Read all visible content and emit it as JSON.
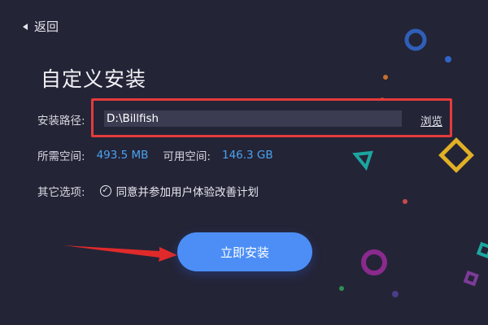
{
  "nav": {
    "back_label": "返回"
  },
  "page": {
    "title": "自定义安装"
  },
  "install_path": {
    "label": "安装路径:",
    "value": "D:\\Billfish",
    "browse_label": "浏览"
  },
  "space": {
    "required_label": "所需空间:",
    "required_value": "493.5 MB",
    "available_label": "可用空间:",
    "available_value": "146.3 GB"
  },
  "options": {
    "label": "其它选项:",
    "agree_label": "同意并参加用户体验改善计划",
    "agree_checked": true
  },
  "actions": {
    "install_label": "立即安装"
  },
  "colors": {
    "background": "#242437",
    "accent": "#4c8ef6",
    "value_text": "#4aa3f0",
    "highlight": "#e43b3b"
  },
  "icons": {
    "back": "back-caret-icon",
    "check": "check-circle-icon",
    "pointer": "red-arrow-icon"
  }
}
